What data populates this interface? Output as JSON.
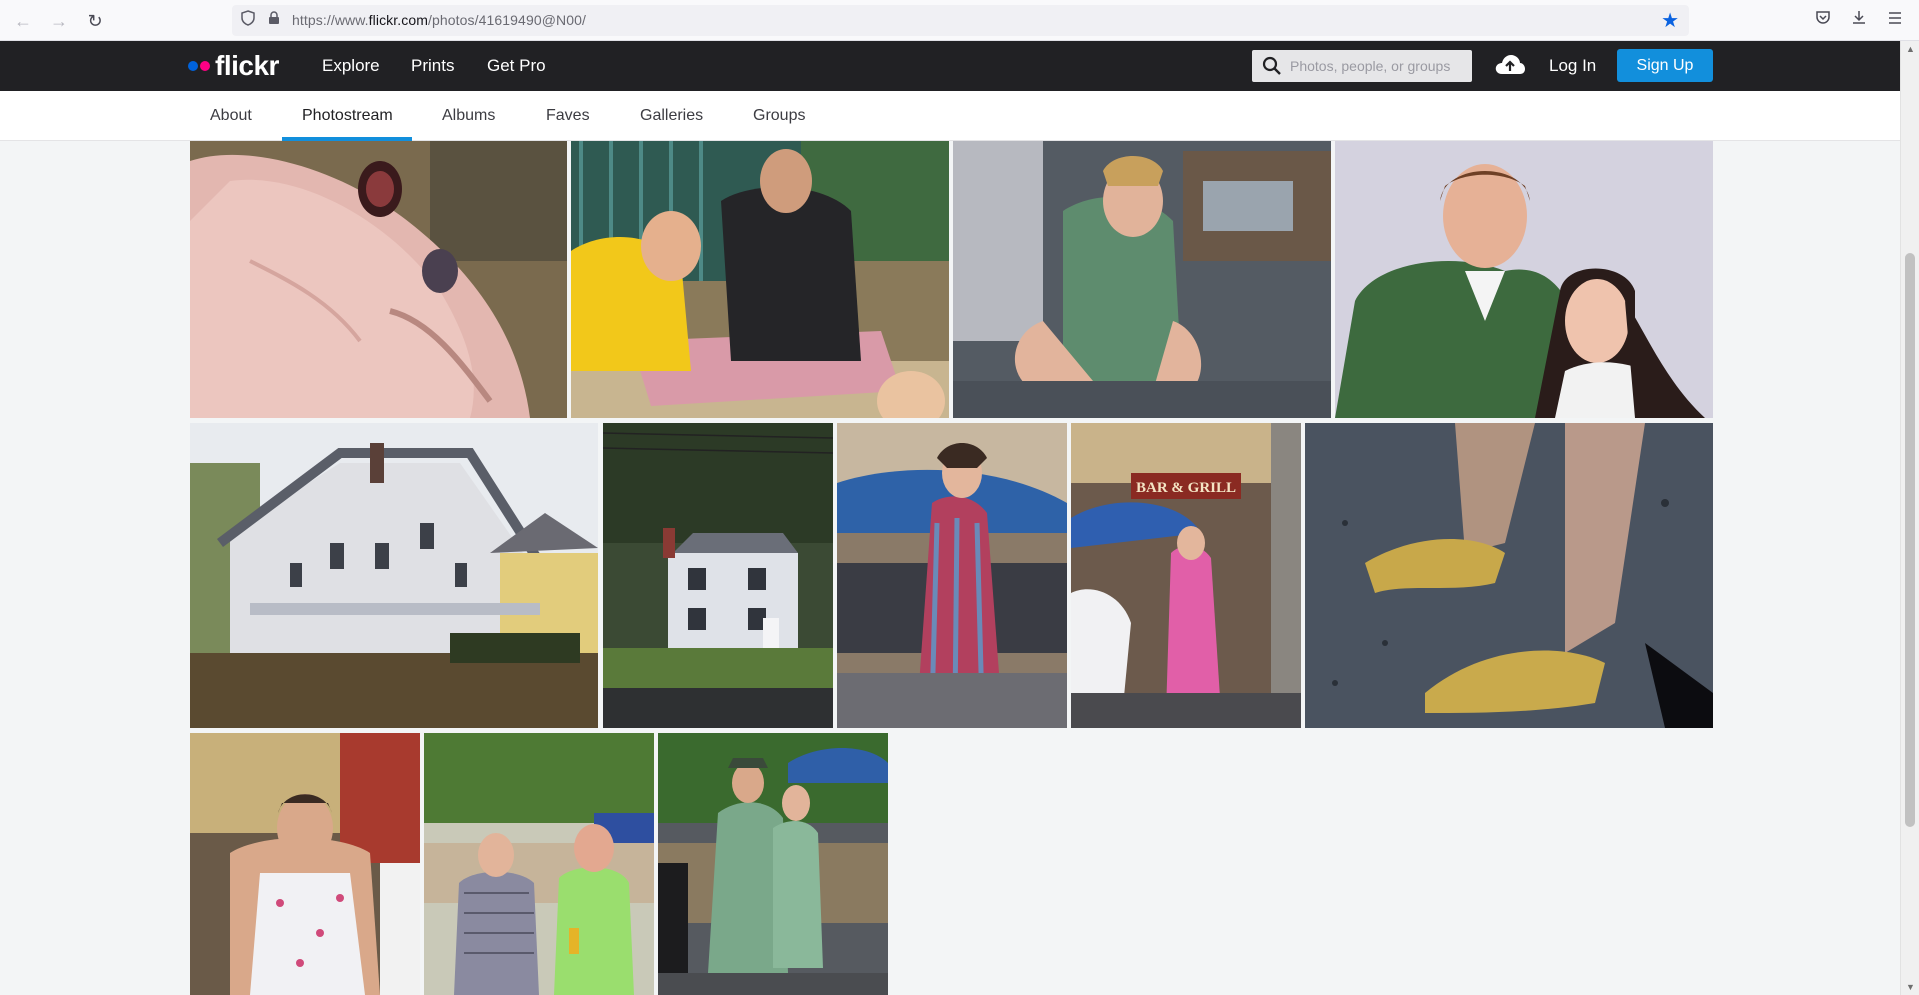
{
  "browser": {
    "url_prefix": "https://www.",
    "url_domain": "flickr.com",
    "url_path": "/photos/41619490@N00/"
  },
  "header": {
    "logo_text": "flickr",
    "nav": [
      "Explore",
      "Prints",
      "Get Pro"
    ],
    "search_placeholder": "Photos, people, or groups",
    "login_label": "Log In",
    "signup_label": "Sign Up"
  },
  "subnav": {
    "tabs": [
      "About",
      "Photostream",
      "Albums",
      "Faves",
      "Galleries",
      "Groups"
    ],
    "active": "Photostream"
  },
  "colors": {
    "brand_blue": "#0063dc",
    "brand_pink": "#ff0084",
    "signup_blue": "#128fdc",
    "header_bg": "#212124"
  },
  "photos": [
    {
      "subject": "pig-closeup"
    },
    {
      "subject": "men-with-pig"
    },
    {
      "subject": "man-in-green-dress"
    },
    {
      "subject": "couple-portrait"
    },
    {
      "subject": "white-house"
    },
    {
      "subject": "small-house"
    },
    {
      "subject": "woman-striped-dress"
    },
    {
      "subject": "bar-and-grill"
    },
    {
      "subject": "gold-heels"
    },
    {
      "subject": "man-in-apron"
    },
    {
      "subject": "two-in-dresses"
    },
    {
      "subject": "pair-in-green-dresses"
    }
  ],
  "photo_text": {
    "bar_sign": "BAR & GRILL"
  }
}
